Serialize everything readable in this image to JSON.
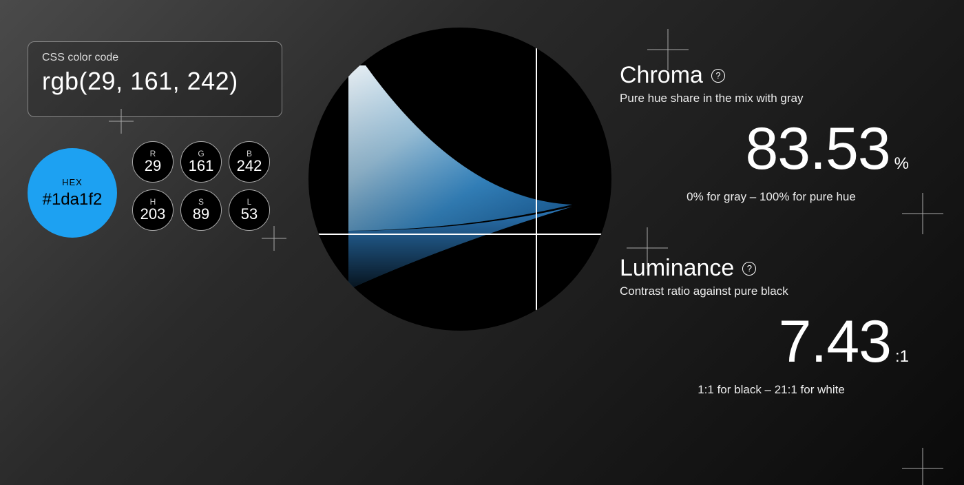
{
  "hex": "#1da1f2",
  "css": {
    "label": "CSS color code",
    "value": "rgb(29, 161, 242)"
  },
  "hex_box": {
    "label": "HEX",
    "value": "#1da1f2"
  },
  "chips": [
    {
      "k": "R",
      "v": "29"
    },
    {
      "k": "G",
      "v": "161"
    },
    {
      "k": "B",
      "v": "242"
    },
    {
      "k": "H",
      "v": "203"
    },
    {
      "k": "S",
      "v": "89"
    },
    {
      "k": "L",
      "v": "53"
    }
  ],
  "chroma": {
    "title": "Chroma",
    "sub": "Pure hue share in the mix with gray",
    "value": "83.53",
    "unit": "%",
    "caption": "0% for gray – 100% for pure hue"
  },
  "luminance": {
    "title": "Luminance",
    "sub": "Contrast ratio against pure black",
    "value": "7.43",
    "unit": ":1",
    "caption": "1:1 for black – 21:1 for white"
  },
  "help_glyph": "?"
}
